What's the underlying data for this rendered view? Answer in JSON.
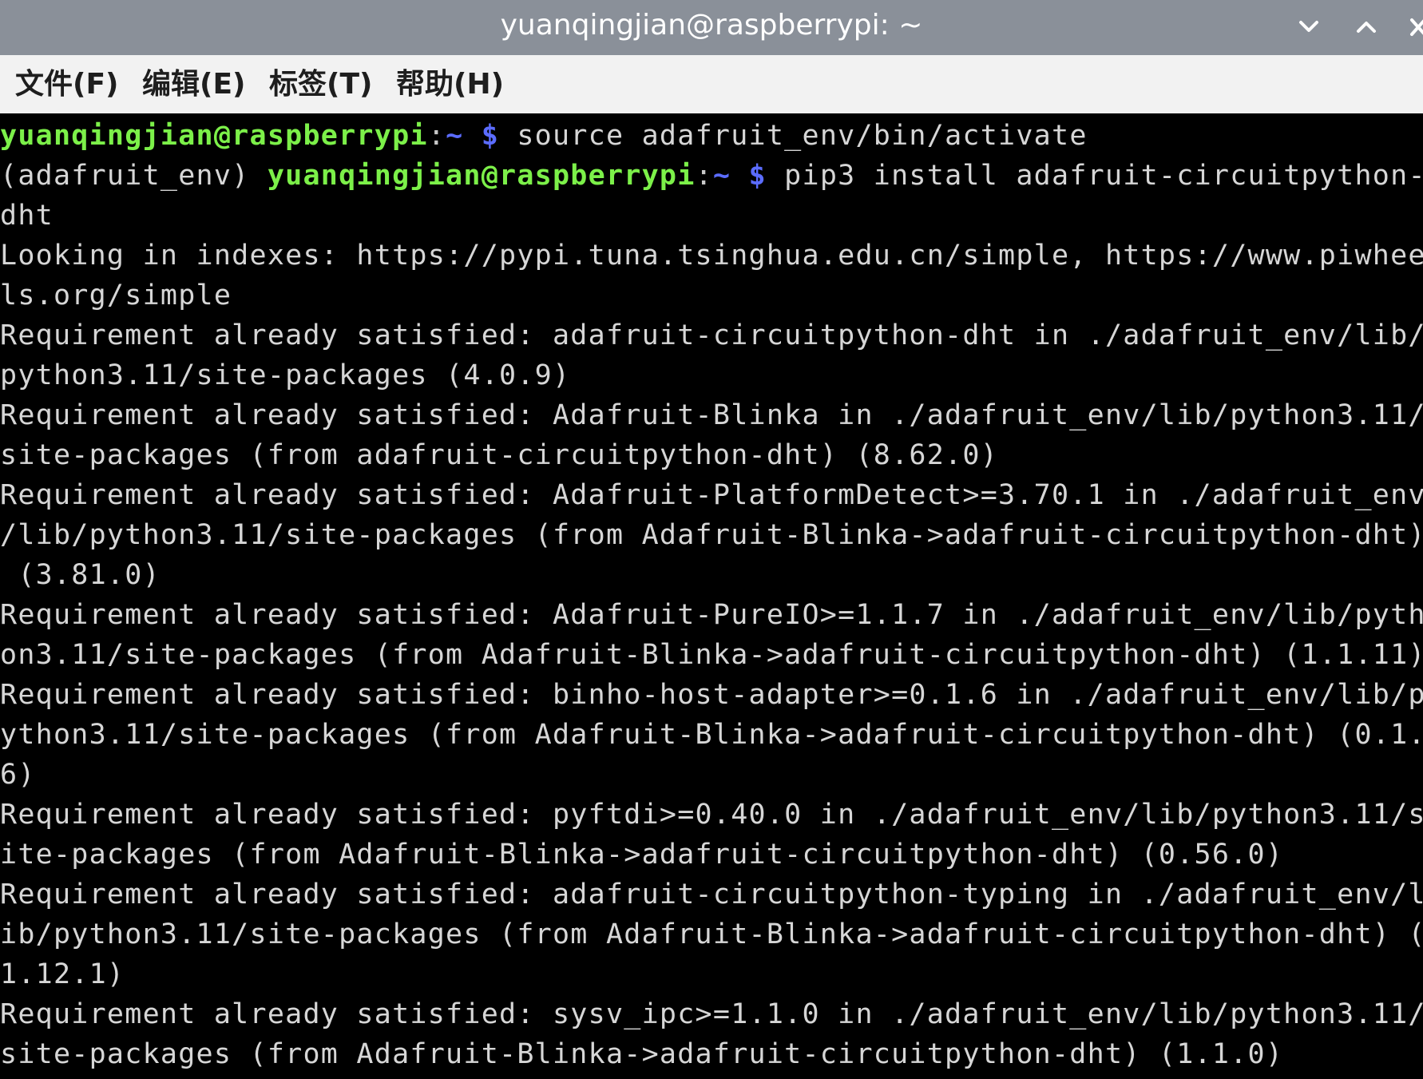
{
  "window": {
    "title": "yuanqingjian@raspberrypi: ~",
    "buttons": [
      "chevron-down-icon",
      "chevron-up-icon",
      "close-icon"
    ]
  },
  "menu": {
    "items": [
      "文件(F)",
      "编辑(E)",
      "标签(T)",
      "帮助(H)"
    ]
  },
  "terminal": {
    "colors": {
      "background": "#000000",
      "text": "#d6d6d6",
      "prompt_user": "#7cf049",
      "prompt_path": "#5b6cff"
    },
    "prompt1": {
      "user_host": "yuanqingjian@raspberrypi",
      "sep": ":",
      "path": "~ $",
      "command": " source adafruit_env/bin/activate"
    },
    "prompt2": {
      "env": "(adafruit_env) ",
      "user_host": "yuanqingjian@raspberrypi",
      "sep": ":",
      "path": "~ $",
      "command": " pip3 install adafruit-circuitpython-"
    },
    "lines": [
      "dht",
      "Looking in indexes: https://pypi.tuna.tsinghua.edu.cn/simple, https://www.piwhee",
      "ls.org/simple",
      "Requirement already satisfied: adafruit-circuitpython-dht in ./adafruit_env/lib/",
      "python3.11/site-packages (4.0.9)",
      "Requirement already satisfied: Adafruit-Blinka in ./adafruit_env/lib/python3.11/",
      "site-packages (from adafruit-circuitpython-dht) (8.62.0)",
      "Requirement already satisfied: Adafruit-PlatformDetect>=3.70.1 in ./adafruit_env",
      "/lib/python3.11/site-packages (from Adafruit-Blinka->adafruit-circuitpython-dht)",
      " (3.81.0)",
      "Requirement already satisfied: Adafruit-PureIO>=1.1.7 in ./adafruit_env/lib/pyth",
      "on3.11/site-packages (from Adafruit-Blinka->adafruit-circuitpython-dht) (1.1.11)",
      "Requirement already satisfied: binho-host-adapter>=0.1.6 in ./adafruit_env/lib/p",
      "ython3.11/site-packages (from Adafruit-Blinka->adafruit-circuitpython-dht) (0.1.",
      "6)",
      "Requirement already satisfied: pyftdi>=0.40.0 in ./adafruit_env/lib/python3.11/s",
      "ite-packages (from Adafruit-Blinka->adafruit-circuitpython-dht) (0.56.0)",
      "Requirement already satisfied: adafruit-circuitpython-typing in ./adafruit_env/l",
      "ib/python3.11/site-packages (from Adafruit-Blinka->adafruit-circuitpython-dht) (",
      "1.12.1)",
      "Requirement already satisfied: sysv_ipc>=1.1.0 in ./adafruit_env/lib/python3.11/",
      "site-packages (from Adafruit-Blinka->adafruit-circuitpython-dht) (1.1.0)"
    ]
  }
}
